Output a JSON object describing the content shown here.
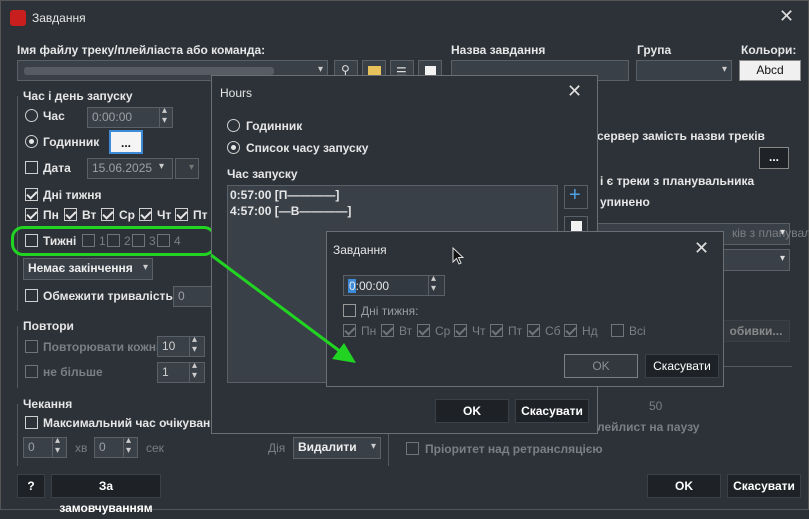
{
  "main": {
    "title": "Завдання",
    "labels": {
      "file_cmd": "Імя файлу треку/плейліаста або команда:",
      "task_name": "Назва завдання",
      "group": "Група",
      "colors": "Кольори:",
      "colors_btn": "Abcd",
      "start_time_section": "Час і день запуску",
      "time": "Час",
      "time_value": "0:00:00",
      "clock": "Годинник",
      "dots": "...",
      "date": "Дата",
      "date_value": "15.06.2025",
      "weekdays": "Дні тижня",
      "weeks": "Тижні",
      "no_end": "Немає закінчення",
      "limit_duration": "Обмежити тривалість",
      "limit_value": "0",
      "repeats_section": "Повтори",
      "repeat_every": "Повторювати кожні",
      "repeat_value": "10",
      "not_more": "не більше",
      "not_more_value": "1",
      "wait_section": "Чекання",
      "max_wait": "Максимальний час очікуван",
      "min_value": "0",
      "min_label": "хв",
      "sec_value": "0",
      "sec_label": "сек",
      "action_label": "Дія",
      "action_value": "Видалити",
      "help": "?",
      "default_btn": "За замовчуванням",
      "ok": "OK",
      "cancel": "Скасувати",
      "server_text": "сервер замість назви треків",
      "planner_text": "і є треки з планувальника",
      "stopped_text": "упинено",
      "adds_btn": "обивки...",
      "playlist_pause": "лейлист на паузу",
      "fifty": "50",
      "priority": "Пріоритет над ретрансляцією",
      "planner_dd": "ків з планувальника"
    },
    "weekday_items": [
      "Пн",
      "Вт",
      "Ср",
      "Чт",
      "Пт"
    ],
    "week_items": [
      "1",
      "2",
      "3",
      "4"
    ]
  },
  "hours": {
    "title": "Hours",
    "clock": "Годинник",
    "list": "Список часу запуску",
    "start_time": "Час запуску",
    "entries": [
      "0:57:00 [П————]",
      "4:57:00 [—В————]"
    ],
    "ok": "OK",
    "cancel": "Скасувати",
    "plus": "+"
  },
  "task": {
    "title": "Завдання",
    "time_value": "0:00:00",
    "weekdays": "Дні тижня:",
    "days": [
      "Пн",
      "Вт",
      "Ср",
      "Чт",
      "Пт",
      "Сб",
      "Нд"
    ],
    "all": "Всі",
    "ok": "OK",
    "cancel": "Скасувати"
  },
  "colors": {
    "annotation": "#22d422"
  }
}
